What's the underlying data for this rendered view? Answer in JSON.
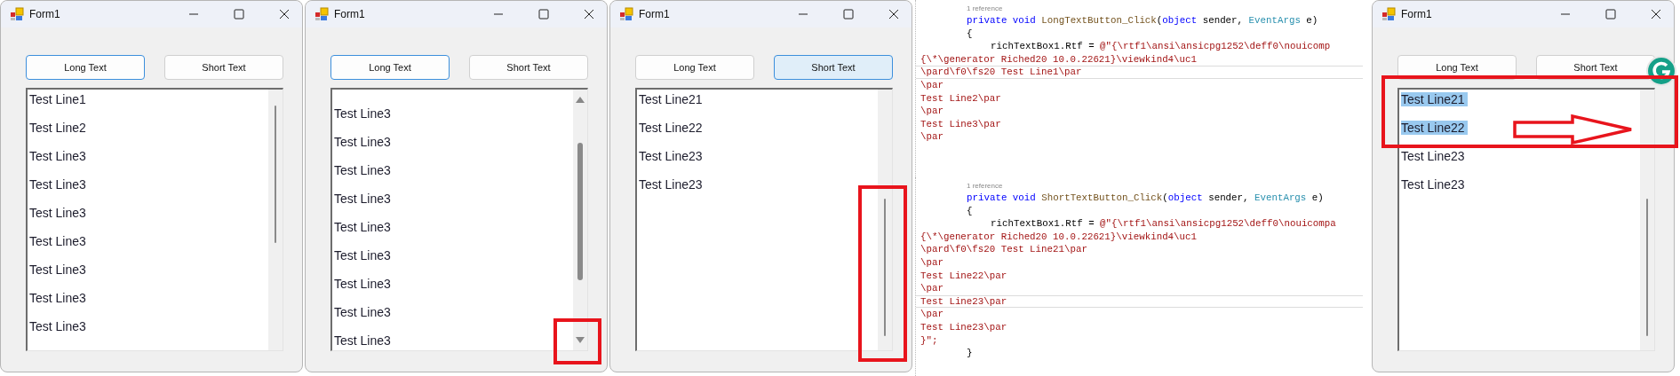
{
  "panels": [
    {
      "kind": "window",
      "title": "Form1",
      "buttons": [
        {
          "label": "Long Text",
          "focused": true,
          "pressed": false
        },
        {
          "label": "Short Text",
          "focused": false,
          "pressed": false
        }
      ],
      "lines": [
        {
          "text": "Test Line1",
          "selected": false
        },
        {
          "text": "Test Line2",
          "selected": false
        },
        {
          "text": "Test Line3",
          "selected": false
        },
        {
          "text": "Test Line3",
          "selected": false
        },
        {
          "text": "Test Line3",
          "selected": false
        },
        {
          "text": "Test Line3",
          "selected": false
        },
        {
          "text": "Test Line3",
          "selected": false
        },
        {
          "text": "Test Line3",
          "selected": false
        },
        {
          "text": "Test Line3",
          "selected": false
        }
      ],
      "scrollbar": {
        "kind": "thin"
      },
      "badge": false
    },
    {
      "kind": "window",
      "title": "Form1",
      "buttons": [
        {
          "label": "Long Text",
          "focused": true,
          "pressed": false
        },
        {
          "label": "Short Text",
          "focused": false,
          "pressed": false
        }
      ],
      "lines": [
        {
          "text": "Test Line3",
          "selected": false
        },
        {
          "text": "Test Line3",
          "selected": false
        },
        {
          "text": "Test Line3",
          "selected": false
        },
        {
          "text": "Test Line3",
          "selected": false
        },
        {
          "text": "Test Line3",
          "selected": false
        },
        {
          "text": "Test Line3",
          "selected": false
        },
        {
          "text": "Test Line3",
          "selected": false
        },
        {
          "text": "Test Line3",
          "selected": false
        },
        {
          "text": "Test Line3",
          "selected": false
        }
      ],
      "scrollbar": {
        "kind": "expanded"
      },
      "annotation": {
        "kind": "downarrow"
      },
      "badge": false
    },
    {
      "kind": "window",
      "title": "Form1",
      "buttons": [
        {
          "label": "Long Text",
          "focused": false,
          "pressed": false
        },
        {
          "label": "Short Text",
          "focused": true,
          "pressed": true
        }
      ],
      "lines": [
        {
          "text": "Test Line21",
          "selected": false
        },
        {
          "text": "Test Line22",
          "selected": false
        },
        {
          "text": "Test Line23",
          "selected": false
        },
        {
          "text": "Test Line23",
          "selected": false
        }
      ],
      "scrollbar": {
        "kind": "lowered"
      },
      "annotation": {
        "kind": "scrollbar"
      },
      "badge": false
    },
    {
      "kind": "code",
      "blocks": [
        {
          "reference": "1 reference",
          "lines": [
            {
              "kind": "signature",
              "current": false,
              "parts": [
                {
                  "kind": "keyword",
                  "text": "private void"
                },
                {
                  "kind": "method",
                  "text": " LongTextButton_Click"
                },
                {
                  "kind": "plain",
                  "text": "("
                },
                {
                  "kind": "keyword",
                  "text": "object"
                },
                {
                  "kind": "plain",
                  "text": " sender, "
                },
                {
                  "kind": "type",
                  "text": "EventArgs"
                },
                {
                  "kind": "plain",
                  "text": " e)"
                }
              ]
            },
            {
              "kind": "brace",
              "current": false,
              "text": "{"
            },
            {
              "kind": "assign",
              "current": false,
              "parts": [
                {
                  "kind": "plain",
                  "text": "richTextBox1.Rtf = "
                },
                {
                  "kind": "string",
                  "text": "@\"{\\rtf1\\ansi\\ansicpg1252\\deff0\\nouicomp"
                }
              ]
            },
            {
              "kind": "string",
              "current": false,
              "text": "{\\*\\generator Riched20 10.0.22621}\\viewkind4\\uc1"
            },
            {
              "kind": "string",
              "current": true,
              "text": "\\pard\\f0\\fs20 Test Line1\\par"
            },
            {
              "kind": "string",
              "current": false,
              "text": "\\par"
            },
            {
              "kind": "string",
              "current": false,
              "text": "Test Line2\\par"
            },
            {
              "kind": "string",
              "current": false,
              "text": "\\par"
            },
            {
              "kind": "string",
              "current": false,
              "text": "Test Line3\\par"
            },
            {
              "kind": "string",
              "current": false,
              "text": "\\par"
            }
          ]
        },
        {
          "reference": "1 reference",
          "lines": [
            {
              "kind": "signature",
              "current": false,
              "parts": [
                {
                  "kind": "keyword",
                  "text": "private void"
                },
                {
                  "kind": "method",
                  "text": " ShortTextButton_Click"
                },
                {
                  "kind": "plain",
                  "text": "("
                },
                {
                  "kind": "keyword",
                  "text": "object"
                },
                {
                  "kind": "plain",
                  "text": " sender, "
                },
                {
                  "kind": "type",
                  "text": "EventArgs"
                },
                {
                  "kind": "plain",
                  "text": " e)"
                }
              ]
            },
            {
              "kind": "brace",
              "current": false,
              "text": "{"
            },
            {
              "kind": "assign",
              "current": false,
              "parts": [
                {
                  "kind": "plain",
                  "text": "richTextBox1.Rtf = "
                },
                {
                  "kind": "string",
                  "text": "@\"{\\rtf1\\ansi\\ansicpg1252\\deff0\\nouicompa"
                }
              ]
            },
            {
              "kind": "string",
              "current": false,
              "text": "{\\*\\generator Riched20 10.0.22621}\\viewkind4\\uc1"
            },
            {
              "kind": "string",
              "current": false,
              "text": "\\pard\\f0\\fs20 Test Line21\\par"
            },
            {
              "kind": "string",
              "current": false,
              "text": "\\par"
            },
            {
              "kind": "string",
              "current": false,
              "text": "Test Line22\\par"
            },
            {
              "kind": "string",
              "current": false,
              "text": "\\par"
            },
            {
              "kind": "string",
              "current": true,
              "text": "Test Line23\\par"
            },
            {
              "kind": "string",
              "current": false,
              "text": "\\par"
            },
            {
              "kind": "string",
              "current": false,
              "text": "Test Line23\\par"
            },
            {
              "kind": "string",
              "current": false,
              "text": "}\";"
            },
            {
              "kind": "brace",
              "current": false,
              "text": "}"
            }
          ]
        }
      ]
    },
    {
      "kind": "window",
      "title": "Form1",
      "buttons": [
        {
          "label": "Long Text",
          "focused": false,
          "pressed": false
        },
        {
          "label": "Short Text",
          "focused": false,
          "pressed": false
        }
      ],
      "lines": [
        {
          "text": "Test Line21",
          "selected": true
        },
        {
          "text": "Test Line22",
          "selected": true
        },
        {
          "text": "Test Line23",
          "selected": false
        },
        {
          "text": "Test Line23",
          "selected": false
        }
      ],
      "scrollbar": {
        "kind": "lowered"
      },
      "annotation": {
        "kind": "selection"
      },
      "badge": true
    }
  ]
}
